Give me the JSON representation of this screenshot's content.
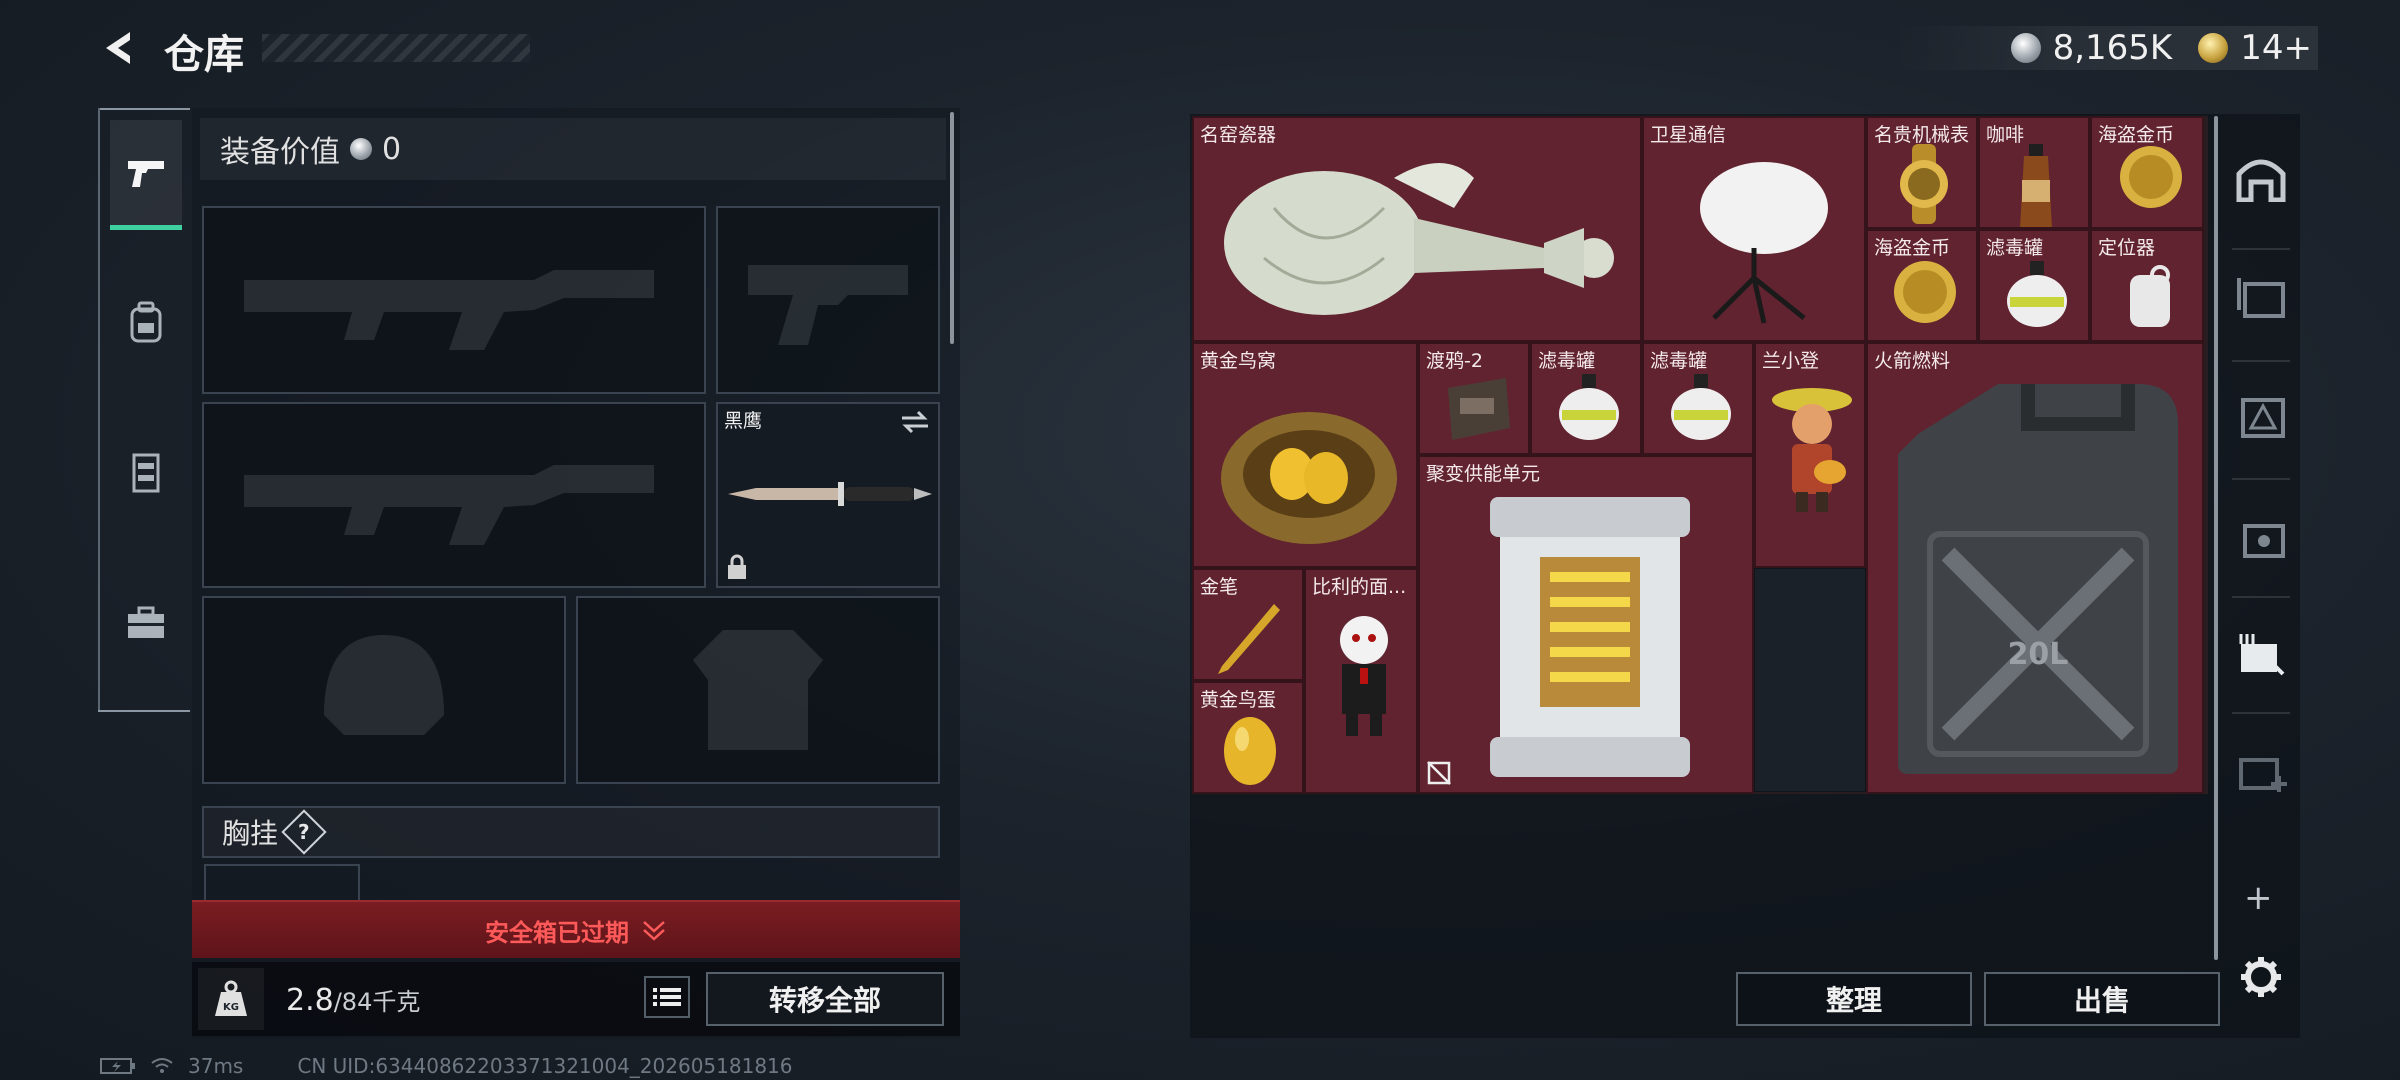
{
  "header": {
    "title": "仓库",
    "currency_silver": "8,165K",
    "currency_gold": "14+"
  },
  "left_tabs": [
    {
      "name": "weapons",
      "active": true
    },
    {
      "name": "backpack",
      "active": false
    },
    {
      "name": "vest",
      "active": false
    },
    {
      "name": "case",
      "active": false
    }
  ],
  "loadout": {
    "equip_value_label": "装备价值",
    "equip_value": "0",
    "melee_name": "黑鹰",
    "chest_label": "胸挂",
    "chest_help": "?",
    "safebox_text": "安全箱已过期",
    "weight_current": "2.8",
    "weight_max": "/84千克",
    "transfer_all": "转移全部"
  },
  "stash": {
    "items": [
      {
        "id": "vase",
        "label": "名窑瓷器"
      },
      {
        "id": "satcom",
        "label": "卫星通信"
      },
      {
        "id": "watch",
        "label": "名贵机械表"
      },
      {
        "id": "coffee",
        "label": "咖啡"
      },
      {
        "id": "coin1",
        "label": "海盗金币"
      },
      {
        "id": "coin2",
        "label": "海盗金币"
      },
      {
        "id": "filter1",
        "label": "滤毒罐"
      },
      {
        "id": "locator",
        "label": "定位器"
      },
      {
        "id": "nest",
        "label": "黄金鸟窝"
      },
      {
        "id": "raven",
        "label": "渡鸦-2"
      },
      {
        "id": "filter2",
        "label": "滤毒罐"
      },
      {
        "id": "filter3",
        "label": "滤毒罐"
      },
      {
        "id": "stool",
        "label": "兰小登"
      },
      {
        "id": "fuel",
        "label": "火箭燃料"
      },
      {
        "id": "fusion",
        "label": "聚变供能单元"
      },
      {
        "id": "pen",
        "label": "金笔"
      },
      {
        "id": "billy",
        "label": "比利的面..."
      },
      {
        "id": "egg",
        "label": "黄金鸟蛋"
      }
    ],
    "organize": "整理",
    "sell": "出售"
  },
  "status_bar": {
    "ping": "37ms",
    "uid": "CN UID:63440862203371321004_202605181816"
  },
  "colors": {
    "item_bg": "#612330",
    "accent_green": "#3fd0a0",
    "warning_red": "#ff5a5a"
  }
}
